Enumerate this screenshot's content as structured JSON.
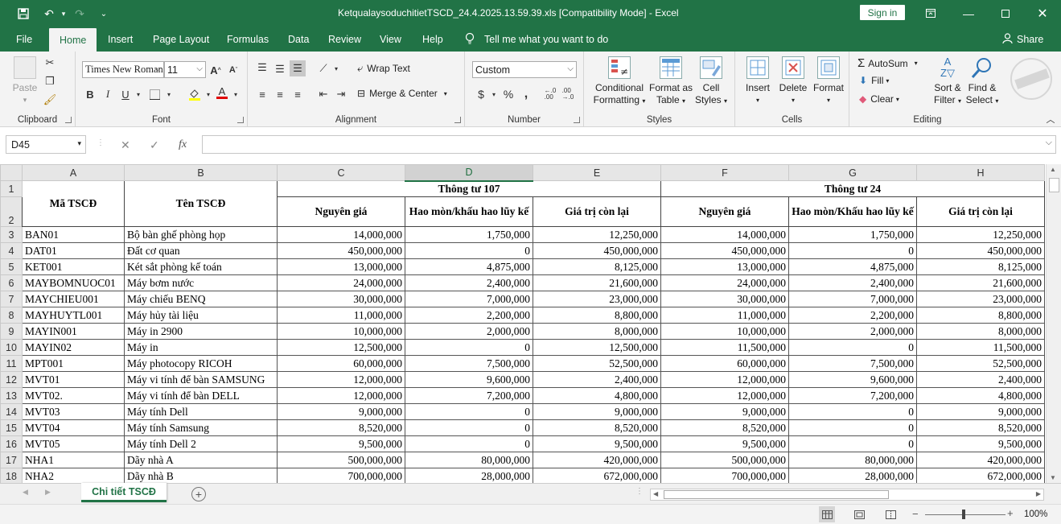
{
  "window": {
    "title": "KetqualaysoduchitietTSCD_24.4.2025.13.59.39.xls  [Compatibility Mode]  -  Excel",
    "signin": "Sign in"
  },
  "tabs": [
    "File",
    "Home",
    "Insert",
    "Page Layout",
    "Formulas",
    "Data",
    "Review",
    "View",
    "Help"
  ],
  "tell_me": "Tell me what you want to do",
  "share": "Share",
  "ribbon": {
    "clipboard": {
      "label": "Clipboard",
      "paste": "Paste"
    },
    "font": {
      "label": "Font",
      "name": "Times New Roman",
      "size": "11"
    },
    "alignment": {
      "label": "Alignment",
      "wrap": "Wrap Text",
      "merge": "Merge & Center"
    },
    "number": {
      "label": "Number",
      "format": "Custom"
    },
    "styles": {
      "label": "Styles",
      "conditional": [
        "Conditional",
        "Formatting"
      ],
      "format_table": [
        "Format as",
        "Table"
      ],
      "cell_styles": [
        "Cell",
        "Styles"
      ]
    },
    "cells": {
      "label": "Cells",
      "insert": "Insert",
      "delete": "Delete",
      "format": "Format"
    },
    "editing": {
      "label": "Editing",
      "autosum": "AutoSum",
      "fill": "Fill",
      "clear": "Clear",
      "sort": [
        "Sort &",
        "Filter"
      ],
      "find": [
        "Find &",
        "Select"
      ]
    }
  },
  "formula_bar": {
    "cell_ref": "D45",
    "fx": "fx",
    "value": ""
  },
  "columns": [
    "A",
    "B",
    "C",
    "D",
    "E",
    "F",
    "G",
    "H"
  ],
  "header": {
    "ma": "Mã TSCĐ",
    "ten": "Tên TSCĐ",
    "tt107": "Thông tư 107",
    "tt24": "Thông tư 24",
    "nguyen_gia": "Nguyên giá",
    "hao_mon_107": "Hao mòn/khấu hao lũy kế",
    "hao_mon_24": "Hao mòn/Khấu hao lũy kế",
    "con_lai": "Giá trị còn lại"
  },
  "rows": [
    {
      "n": "3",
      "a": "BAN01",
      "b": "Bộ bàn ghế phòng họp",
      "c": "14,000,000",
      "d": "1,750,000",
      "e": "12,250,000",
      "f": "14,000,000",
      "g": "1,750,000",
      "h": "12,250,000"
    },
    {
      "n": "4",
      "a": "DAT01",
      "b": "Đất cơ quan",
      "c": "450,000,000",
      "d": "0",
      "e": "450,000,000",
      "f": "450,000,000",
      "g": "0",
      "h": "450,000,000"
    },
    {
      "n": "5",
      "a": "KET001",
      "b": "Két sắt phòng kế toán",
      "c": "13,000,000",
      "d": "4,875,000",
      "e": "8,125,000",
      "f": "13,000,000",
      "g": "4,875,000",
      "h": "8,125,000"
    },
    {
      "n": "6",
      "a": "MAYBOMNUOC01",
      "b": "Máy bơm nước",
      "c": "24,000,000",
      "d": "2,400,000",
      "e": "21,600,000",
      "f": "24,000,000",
      "g": "2,400,000",
      "h": "21,600,000"
    },
    {
      "n": "7",
      "a": "MAYCHIEU001",
      "b": "Máy chiếu BENQ",
      "c": "30,000,000",
      "d": "7,000,000",
      "e": "23,000,000",
      "f": "30,000,000",
      "g": "7,000,000",
      "h": "23,000,000"
    },
    {
      "n": "8",
      "a": "MAYHUYTL001",
      "b": "Máy hủy tài liệu",
      "c": "11,000,000",
      "d": "2,200,000",
      "e": "8,800,000",
      "f": "11,000,000",
      "g": "2,200,000",
      "h": "8,800,000"
    },
    {
      "n": "9",
      "a": "MAYIN001",
      "b": "Máy in 2900",
      "c": "10,000,000",
      "d": "2,000,000",
      "e": "8,000,000",
      "f": "10,000,000",
      "g": "2,000,000",
      "h": "8,000,000"
    },
    {
      "n": "10",
      "a": "MAYIN02",
      "b": "Máy in",
      "c": "12,500,000",
      "d": "0",
      "e": "12,500,000",
      "f": "11,500,000",
      "g": "0",
      "h": "11,500,000"
    },
    {
      "n": "11",
      "a": "MPT001",
      "b": "Máy photocopy RICOH",
      "c": "60,000,000",
      "d": "7,500,000",
      "e": "52,500,000",
      "f": "60,000,000",
      "g": "7,500,000",
      "h": "52,500,000"
    },
    {
      "n": "12",
      "a": "MVT01",
      "b": "Máy vi tính để bàn SAMSUNG",
      "c": "12,000,000",
      "d": "9,600,000",
      "e": "2,400,000",
      "f": "12,000,000",
      "g": "9,600,000",
      "h": "2,400,000"
    },
    {
      "n": "13",
      "a": "MVT02.",
      "b": "Máy vi tính để bàn DELL",
      "c": "12,000,000",
      "d": "7,200,000",
      "e": "4,800,000",
      "f": "12,000,000",
      "g": "7,200,000",
      "h": "4,800,000"
    },
    {
      "n": "14",
      "a": "MVT03",
      "b": "Máy tính Dell",
      "c": "9,000,000",
      "d": "0",
      "e": "9,000,000",
      "f": "9,000,000",
      "g": "0",
      "h": "9,000,000"
    },
    {
      "n": "15",
      "a": "MVT04",
      "b": "Máy tính Samsung",
      "c": "8,520,000",
      "d": "0",
      "e": "8,520,000",
      "f": "8,520,000",
      "g": "0",
      "h": "8,520,000"
    },
    {
      "n": "16",
      "a": "MVT05",
      "b": "Máy tính Dell 2",
      "c": "9,500,000",
      "d": "0",
      "e": "9,500,000",
      "f": "9,500,000",
      "g": "0",
      "h": "9,500,000"
    },
    {
      "n": "17",
      "a": "NHA1",
      "b": "Dãy nhà A",
      "c": "500,000,000",
      "d": "80,000,000",
      "e": "420,000,000",
      "f": "500,000,000",
      "g": "80,000,000",
      "h": "420,000,000"
    },
    {
      "n": "18",
      "a": "NHA2",
      "b": "Dãy nhà B",
      "c": "700,000,000",
      "d": "28,000,000",
      "e": "672,000,000",
      "f": "700,000,000",
      "g": "28,000,000",
      "h": "672,000,000"
    }
  ],
  "sheet_tab": "Chi tiết TSCĐ",
  "zoom": "100%",
  "colors": {
    "accent": "#217346"
  }
}
